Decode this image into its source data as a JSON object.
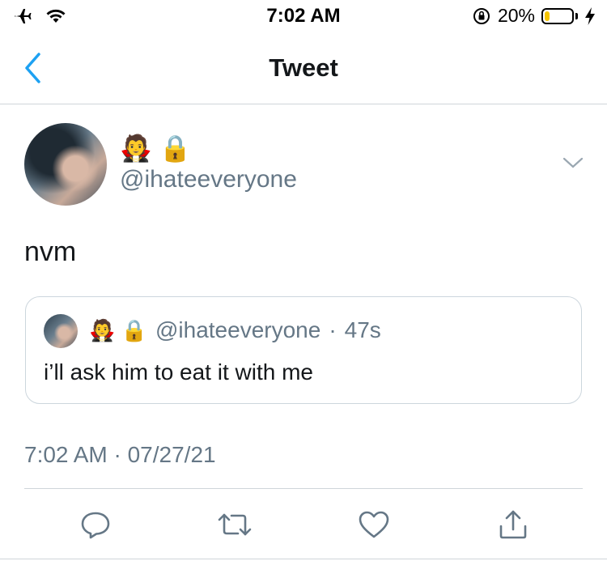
{
  "status_bar": {
    "time": "7:02 AM",
    "battery_percent": "20%",
    "battery_level": 0.2,
    "battery_color": "#f5c400"
  },
  "nav": {
    "title": "Tweet",
    "back_icon": "chevron-left-icon",
    "accent_color": "#1da1f2"
  },
  "tweet": {
    "name_emojis": "🧛 🔒",
    "handle": "@ihateeveryone",
    "text": "nvm",
    "timestamp": "7:02 AM · 07/27/21",
    "quoted": {
      "name_emojis": "🧛 🔒",
      "handle": "@ihateeveryone",
      "separator": "·",
      "time_ago": "47s",
      "text": "i’ll ask him to eat it with me"
    }
  },
  "actions": [
    {
      "name": "reply",
      "icon": "reply-icon"
    },
    {
      "name": "retweet",
      "icon": "retweet-icon"
    },
    {
      "name": "like",
      "icon": "heart-icon"
    },
    {
      "name": "share",
      "icon": "share-icon"
    }
  ]
}
